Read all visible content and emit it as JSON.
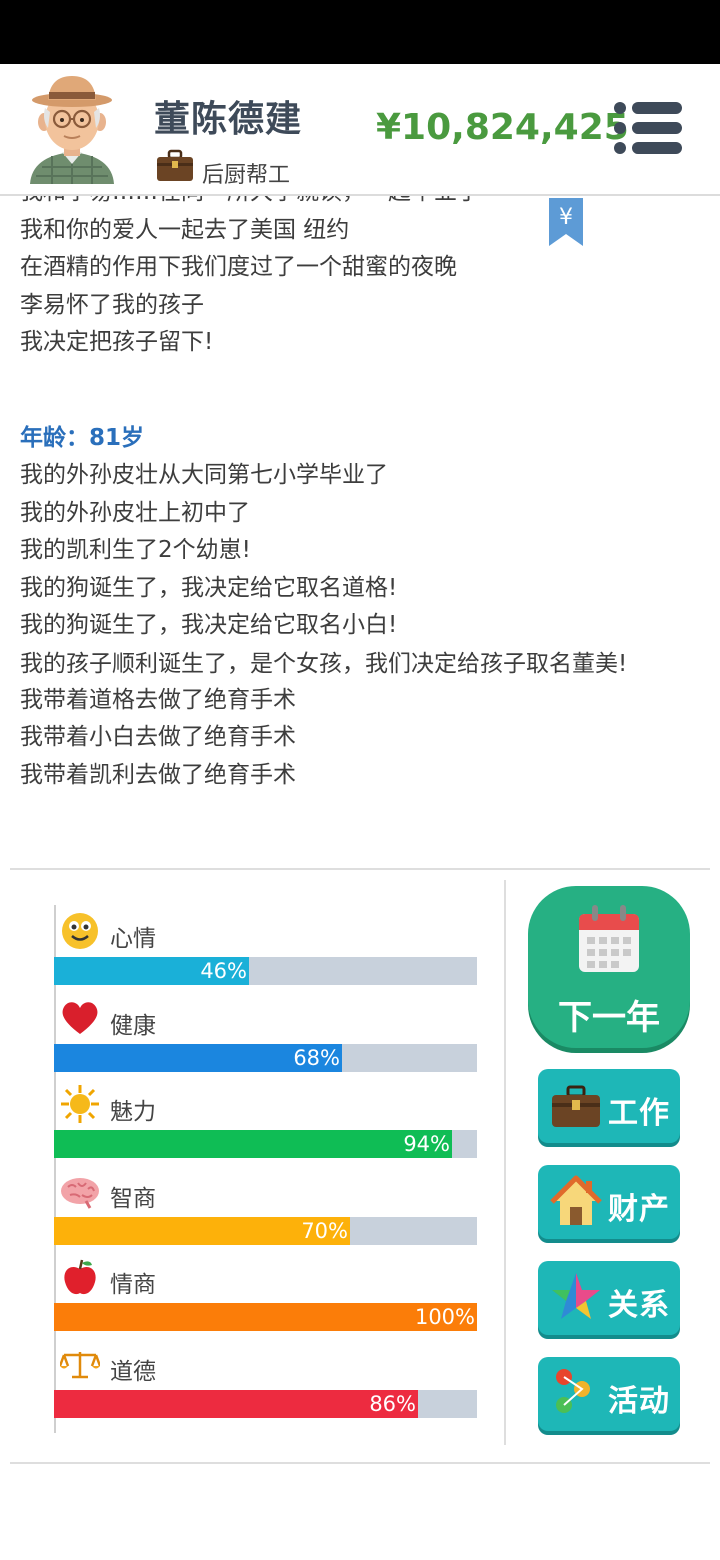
{
  "header": {
    "name": "董陈德建",
    "job": "后厨帮工",
    "money": "¥10,824,425",
    "bookmark_symbol": "¥"
  },
  "log": {
    "partial_line": "我和李易……在同一所大学就读，一起毕业了",
    "lines_before": [
      "我和你的爱人一起去了美国 纽约",
      "在酒精的作用下我们度过了一个甜蜜的夜晚",
      "李易怀了我的孩子",
      "我决定把孩子留下!"
    ],
    "age_label": "年龄：81岁",
    "lines_after": [
      "我的外孙皮壮从大同第七小学毕业了",
      "我的外孙皮壮上初中了",
      "我的凯利生了2个幼崽!",
      "我的狗诞生了，我决定给它取名道格!",
      "我的狗诞生了，我决定给它取名小白!",
      "我的孩子顺利诞生了，是个女孩，我们决定给孩子取名董美!",
      "我带着道格去做了绝育手术",
      "我带着小白去做了绝育手术",
      "我带着凯利去做了绝育手术"
    ]
  },
  "stats": [
    {
      "label": "心情",
      "value": 46,
      "text": "46%",
      "color": "#1ab0d8",
      "icon": "smiley-face-icon"
    },
    {
      "label": "健康",
      "value": 68,
      "text": "68%",
      "color": "#1b86df",
      "icon": "heart-icon"
    },
    {
      "label": "魅力",
      "value": 94,
      "text": "94%",
      "color": "#0fbd55",
      "icon": "sun-icon"
    },
    {
      "label": "智商",
      "value": 70,
      "text": "70%",
      "color": "#fdb10a",
      "icon": "brain-icon"
    },
    {
      "label": "情商",
      "value": 100,
      "text": "100%",
      "color": "#fb7d09",
      "icon": "apple-icon"
    },
    {
      "label": "道德",
      "value": 86,
      "text": "86%",
      "color": "#ed2b40",
      "icon": "scales-icon"
    }
  ],
  "buttons": {
    "next_year": "下一年",
    "work": "工作",
    "assets": "财产",
    "relations": "关系",
    "activities": "活动"
  }
}
